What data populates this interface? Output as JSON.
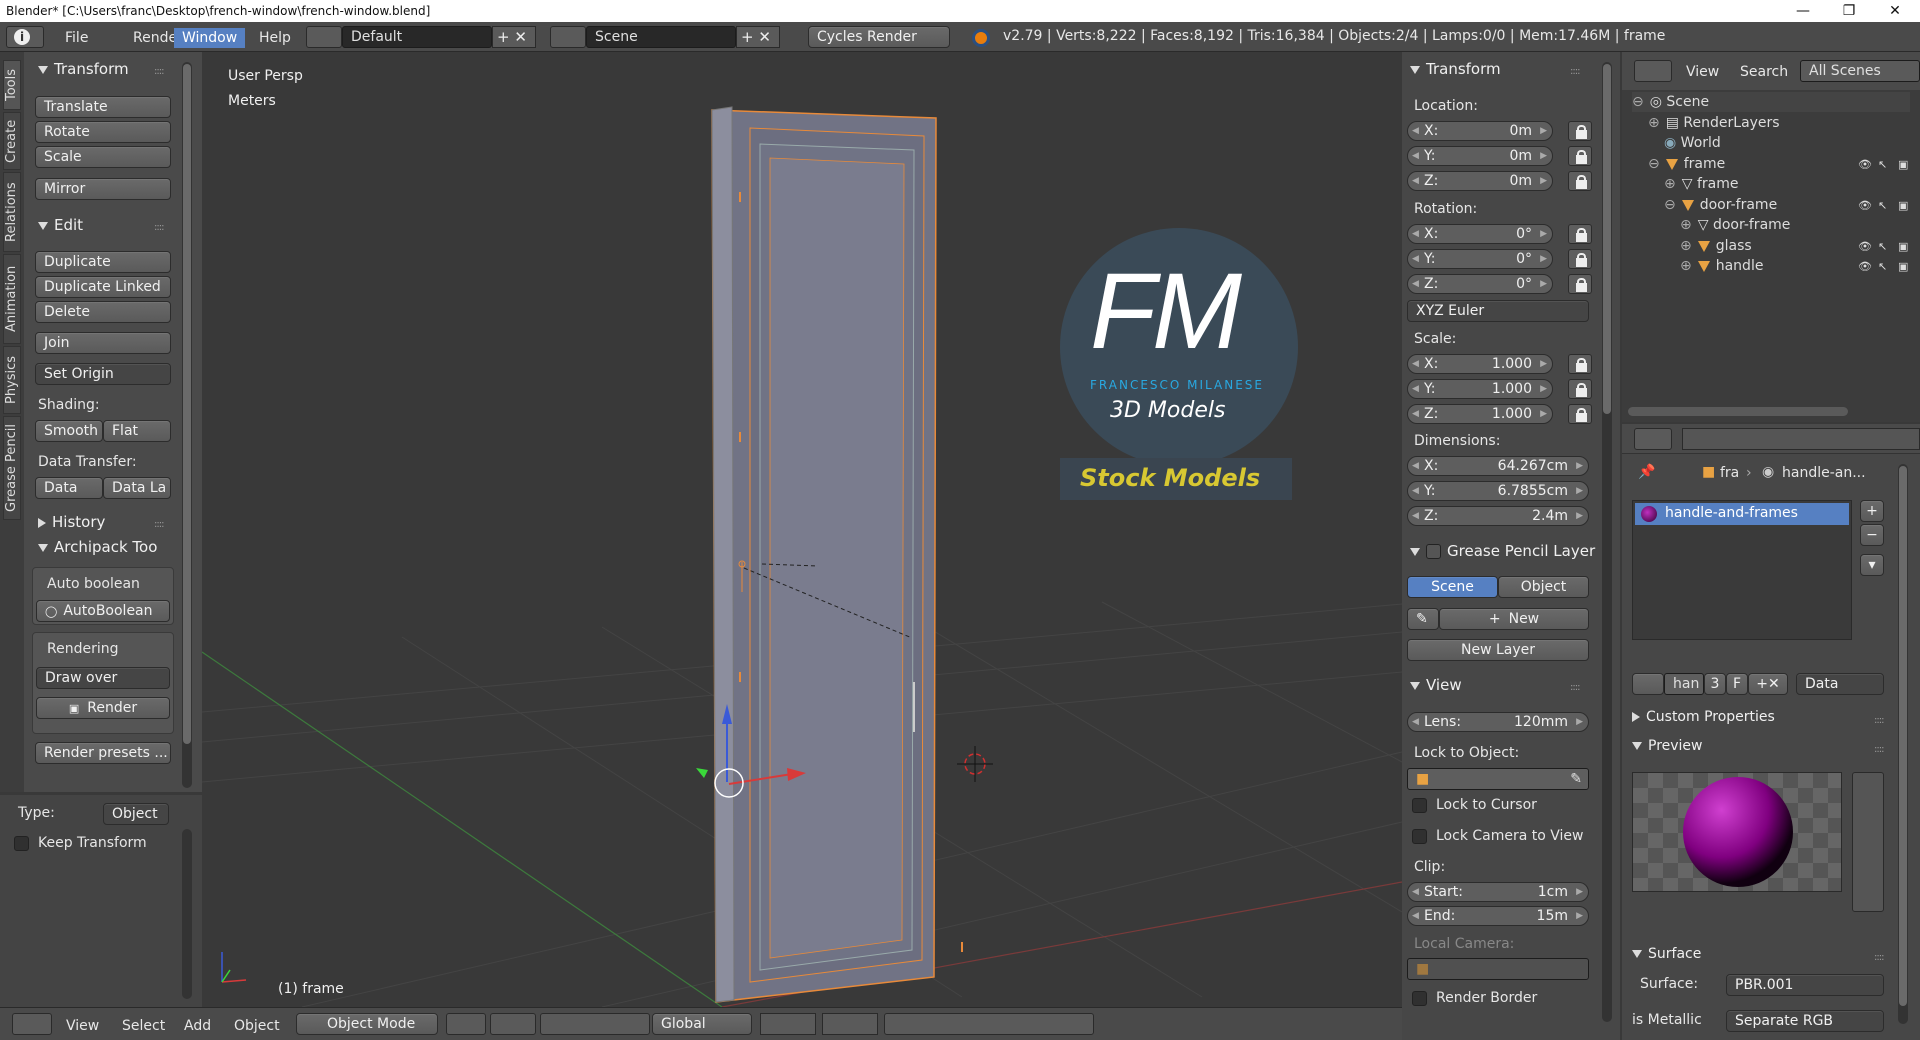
{
  "window": {
    "title": "Blender* [C:\\Users\\franc\\Desktop\\french-window\\french-window.blend]",
    "minimize": "—",
    "maximize": "❐",
    "close": "✕"
  },
  "topbar": {
    "menus": [
      "File",
      "Render",
      "Window",
      "Help"
    ],
    "active_menu": "Window",
    "layout": "Default",
    "scene": "Scene",
    "engine": "Cycles Render",
    "stats": "v2.79 | Verts:8,222 | Faces:8,192 | Tris:16,384 | Objects:2/4 | Lamps:0/0 | Mem:17.46M | frame"
  },
  "left_tabs": [
    "Tools",
    "Create",
    "Relations",
    "Animation",
    "Physics",
    "Grease Pencil"
  ],
  "toolshelf": {
    "transform_header": "Transform",
    "translate": "Translate",
    "rotate": "Rotate",
    "scale": "Scale",
    "mirror": "Mirror",
    "edit_header": "Edit",
    "duplicate": "Duplicate",
    "duplicate_linked": "Duplicate Linked",
    "delete": "Delete",
    "join": "Join",
    "set_origin": "Set Origin",
    "shading_label": "Shading:",
    "smooth": "Smooth",
    "flat": "Flat",
    "data_transfer_label": "Data Transfer:",
    "data": "Data",
    "data_la": "Data La",
    "history_header": "History",
    "archipack_header": "Archipack Too",
    "auto_boolean_label": "Auto boolean",
    "autoboolean_btn": "AutoBoolean",
    "rendering_label": "Rendering",
    "draw_over": "Draw over",
    "render_btn": "Render",
    "render_presets": "Render presets ...",
    "type_label": "Type:",
    "type_value": "Object",
    "keep_transform": "Keep Transform"
  },
  "viewport": {
    "persp": "User Persp",
    "units": "Meters",
    "object_label": "(1) frame",
    "logo_letters": "FM",
    "logo_name": "FRANCESCO MILANESE",
    "logo_sub": "3D Models",
    "logo_banner": "Stock Models"
  },
  "bottombar": {
    "view": "View",
    "select": "Select",
    "add": "Add",
    "object": "Object",
    "mode": "Object Mode",
    "orientation": "Global"
  },
  "properties_n": {
    "transform_header": "Transform",
    "location_label": "Location:",
    "location": [
      {
        "k": "X:",
        "v": "0m"
      },
      {
        "k": "Y:",
        "v": "0m"
      },
      {
        "k": "Z:",
        "v": "0m"
      }
    ],
    "rotation_label": "Rotation:",
    "rotation": [
      {
        "k": "X:",
        "v": "0°"
      },
      {
        "k": "Y:",
        "v": "0°"
      },
      {
        "k": "Z:",
        "v": "0°"
      }
    ],
    "rotation_mode": "XYZ Euler",
    "scale_label": "Scale:",
    "scale": [
      {
        "k": "X:",
        "v": "1.000"
      },
      {
        "k": "Y:",
        "v": "1.000"
      },
      {
        "k": "Z:",
        "v": "1.000"
      }
    ],
    "dimensions_label": "Dimensions:",
    "dimensions": [
      {
        "k": "X:",
        "v": "64.267cm"
      },
      {
        "k": "Y:",
        "v": "6.7855cm"
      },
      {
        "k": "Z:",
        "v": "2.4m"
      }
    ],
    "grease_header": "Grease Pencil Layer",
    "scene_tab": "Scene",
    "object_tab": "Object",
    "new_btn": "New",
    "new_layer": "New Layer",
    "view_header": "View",
    "lens_k": "Lens:",
    "lens_v": "120mm",
    "lock_to_object": "Lock to Object:",
    "lock_to_cursor": "Lock to Cursor",
    "lock_camera": "Lock Camera to View",
    "clip_label": "Clip:",
    "clip_start_k": "Start:",
    "clip_start_v": "1cm",
    "clip_end_k": "End:",
    "clip_end_v": "15m",
    "local_camera": "Local Camera:",
    "render_border": "Render Border"
  },
  "outliner": {
    "view": "View",
    "search": "Search",
    "all_scenes": "All Scenes",
    "rows": [
      "Scene",
      "RenderLayers",
      "World",
      "frame",
      "frame",
      "door-frame",
      "door-frame",
      "glass",
      "handle"
    ]
  },
  "material": {
    "breadcrumb_1": "fra",
    "breadcrumb_2": "handle-an...",
    "slot": "handle-and-frames",
    "name_short": "han",
    "users": "3",
    "fake": "F",
    "link": "Data",
    "custom_props": "Custom Properties",
    "preview": "Preview",
    "surface_header": "Surface",
    "surface_label": "Surface:",
    "surface_value": "PBR.001",
    "is_metallic": "is Metallic",
    "is_metallic_value": "Separate RGB"
  }
}
